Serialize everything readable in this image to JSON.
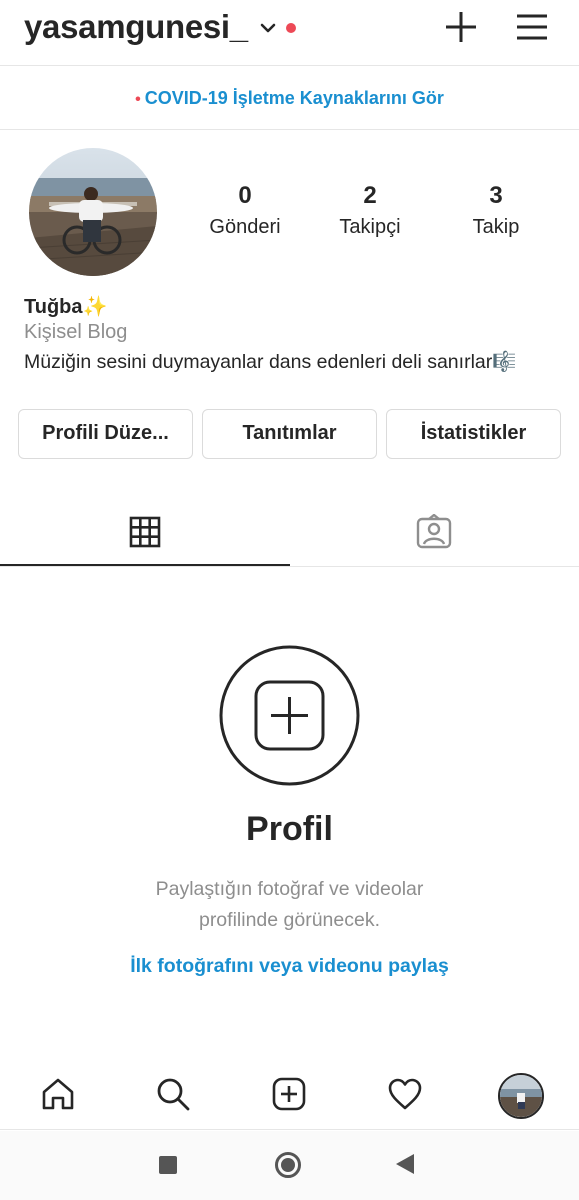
{
  "header": {
    "username": "yasamgunesi_",
    "account_switch_icon": "chevron-down-icon",
    "notification_dot_color": "#ed4956",
    "create_icon": "plus-icon",
    "menu_icon": "hamburger-menu-icon"
  },
  "banner": {
    "text": "COVID-19 İşletme Kaynaklarını Gör",
    "color": "#1a8fd0"
  },
  "stats": [
    {
      "value": "0",
      "label": "Gönderi"
    },
    {
      "value": "2",
      "label": "Takipçi"
    },
    {
      "value": "3",
      "label": "Takip"
    }
  ],
  "bio": {
    "name": "Tuğba✨",
    "category": "Kişisel Blog",
    "text": "Müziğin sesini duymayanlar dans edenleri deli sanırlar🎼"
  },
  "buttons": {
    "edit_profile": "Profili Düze...",
    "promotions": "Tanıtımlar",
    "insights": "İstatistikler"
  },
  "tabs": [
    {
      "icon": "grid-icon",
      "active": true
    },
    {
      "icon": "tagged-icon",
      "active": false
    }
  ],
  "empty_state": {
    "icon": "add-post-icon",
    "title": "Profil",
    "description_line1": "Paylaştığın fotoğraf ve videolar",
    "description_line2": "profilinde görünecek.",
    "link": "İlk fotoğrafını veya videonu paylaş"
  },
  "bottom_nav": [
    {
      "icon": "home-icon"
    },
    {
      "icon": "search-icon"
    },
    {
      "icon": "add-icon"
    },
    {
      "icon": "heart-icon"
    },
    {
      "icon": "profile-avatar"
    }
  ],
  "system_nav": [
    {
      "icon": "recents-icon"
    },
    {
      "icon": "home-circle-icon"
    },
    {
      "icon": "back-icon"
    }
  ]
}
